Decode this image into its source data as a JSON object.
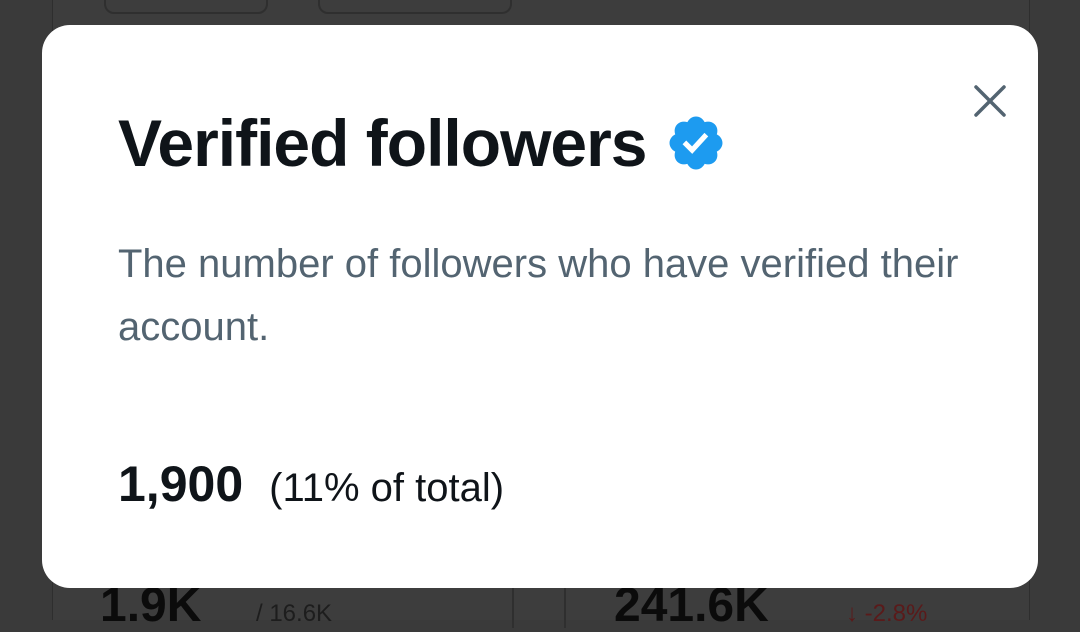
{
  "background": {
    "left_stat": "1.9K",
    "left_sub": "/ 16.6K",
    "right_stat": "241.6K",
    "right_sub": "↓ -2.8%"
  },
  "modal": {
    "title": "Verified followers",
    "title_icon": "verified-badge-icon",
    "description": "The number of followers who have verified their account.",
    "stat_value": "1,900",
    "stat_percent": "(11% of total)",
    "close_icon": "close-icon"
  },
  "colors": {
    "verified_blue": "#1d9bf0",
    "title_text": "#0f1419",
    "secondary_text": "#536471",
    "backdrop": "#3a3a3a"
  }
}
